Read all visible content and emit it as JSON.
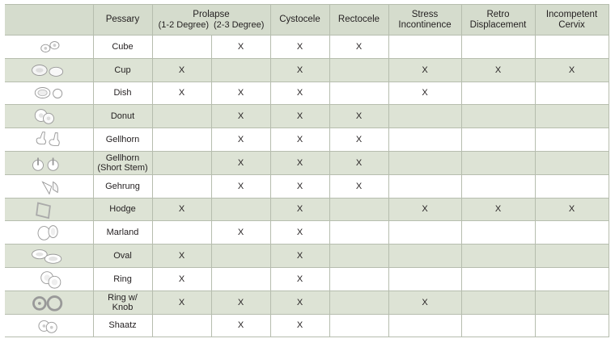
{
  "columns": {
    "pessary": "Pessary",
    "prolapse": "Prolapse",
    "prolapse_sub1": "(1-2 Degree)",
    "prolapse_sub2": "(2-3 Degree)",
    "cystocele": "Cystocele",
    "rectocele": "Rectocele",
    "stress_l1": "Stress",
    "stress_l2": "Incontinence",
    "retro_l1": "Retro",
    "retro_l2": "Displacement",
    "incomp_l1": "Incompetent",
    "incomp_l2": "Cervix"
  },
  "rows": [
    {
      "name": "Cube",
      "name2": "",
      "icon": "cube-pessary-icon",
      "cells": [
        "",
        "X",
        "X",
        "X",
        "",
        "",
        ""
      ]
    },
    {
      "name": "Cup",
      "name2": "",
      "icon": "cup-pessary-icon",
      "cells": [
        "X",
        "",
        "X",
        "",
        "X",
        "X",
        "X"
      ]
    },
    {
      "name": "Dish",
      "name2": "",
      "icon": "dish-pessary-icon",
      "cells": [
        "X",
        "X",
        "X",
        "",
        "X",
        "",
        ""
      ]
    },
    {
      "name": "Donut",
      "name2": "",
      "icon": "donut-pessary-icon",
      "cells": [
        "",
        "X",
        "X",
        "X",
        "",
        "",
        ""
      ]
    },
    {
      "name": "Gellhorn",
      "name2": "",
      "icon": "gellhorn-pessary-icon",
      "cells": [
        "",
        "X",
        "X",
        "X",
        "",
        "",
        ""
      ]
    },
    {
      "name": "Gellhorn",
      "name2": "(Short Stem)",
      "icon": "gellhorn-short-stem-pessary-icon",
      "cells": [
        "",
        "X",
        "X",
        "X",
        "",
        "",
        ""
      ]
    },
    {
      "name": "Gehrung",
      "name2": "",
      "icon": "gehrung-pessary-icon",
      "cells": [
        "",
        "X",
        "X",
        "X",
        "",
        "",
        ""
      ]
    },
    {
      "name": "Hodge",
      "name2": "",
      "icon": "hodge-pessary-icon",
      "cells": [
        "X",
        "",
        "X",
        "",
        "X",
        "X",
        "X"
      ]
    },
    {
      "name": "Marland",
      "name2": "",
      "icon": "marland-pessary-icon",
      "cells": [
        "",
        "X",
        "X",
        "",
        "",
        "",
        ""
      ]
    },
    {
      "name": "Oval",
      "name2": "",
      "icon": "oval-pessary-icon",
      "cells": [
        "X",
        "",
        "X",
        "",
        "",
        "",
        ""
      ]
    },
    {
      "name": "Ring",
      "name2": "",
      "icon": "ring-pessary-icon",
      "cells": [
        "X",
        "",
        "X",
        "",
        "",
        "",
        ""
      ]
    },
    {
      "name": "Ring w/",
      "name2": "Knob",
      "icon": "ring-with-knob-pessary-icon",
      "cells": [
        "X",
        "X",
        "X",
        "",
        "X",
        "",
        ""
      ]
    },
    {
      "name": "Shaatz",
      "name2": "",
      "icon": "shaatz-pessary-icon",
      "cells": [
        "",
        "X",
        "X",
        "",
        "",
        "",
        ""
      ]
    }
  ],
  "colors": {
    "header_bg": "#d5dccd",
    "stripe_bg": "#dde3d5",
    "border": "#b6bdae"
  }
}
